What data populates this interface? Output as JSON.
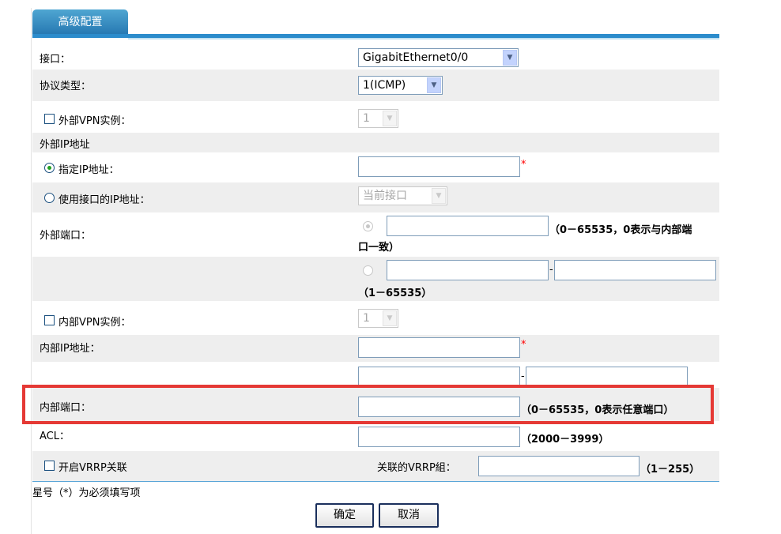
{
  "tab": {
    "title": "高级配置"
  },
  "rows": {
    "interface": {
      "label": "接口：",
      "value": "GigabitEthernet0/0"
    },
    "protocol": {
      "label": "协议类型：",
      "value": "1(ICMP)"
    },
    "ext_vpn": {
      "label": "外部VPN实例：",
      "value": "1"
    },
    "ext_ip_header": {
      "label": "外部IP地址"
    },
    "ext_ip_specify": {
      "label": "指定IP地址：",
      "value": "",
      "required_mark": "*"
    },
    "ext_ip_use_if": {
      "label": "使用接口的IP地址：",
      "value": "当前接口"
    },
    "ext_port": {
      "label": "外部端口：",
      "single_value": "",
      "single_hint_line1": "（0－65535，0表示与内部端",
      "single_hint_line2": "口一致）",
      "range_start": "",
      "range_sep": "-",
      "range_end": "",
      "range_hint": "（1－65535）"
    },
    "int_vpn": {
      "label": "内部VPN实例：",
      "value": "1"
    },
    "int_ip": {
      "label": "内部IP地址：",
      "value": "",
      "required_mark": "*",
      "range_start": "",
      "range_sep": "-",
      "range_end": ""
    },
    "int_port": {
      "label": "内部端口：",
      "value": "",
      "hint": "（0－65535，0表示任意端口）"
    },
    "acl": {
      "label": "ACL：",
      "value": "",
      "hint": "（2000－3999）"
    },
    "vrrp": {
      "label": "开启VRRP关联",
      "group_label": "关联的VRRP組：",
      "value": "",
      "hint": "（1－255）"
    }
  },
  "footer": {
    "note": "星号（*）为必须填写项"
  },
  "buttons": {
    "ok": "确定",
    "cancel": "取消"
  },
  "colors": {
    "tab": "#2779b3",
    "highlight": "#e53935",
    "required": "#ff0000",
    "row_gray": "#eeeeee"
  }
}
